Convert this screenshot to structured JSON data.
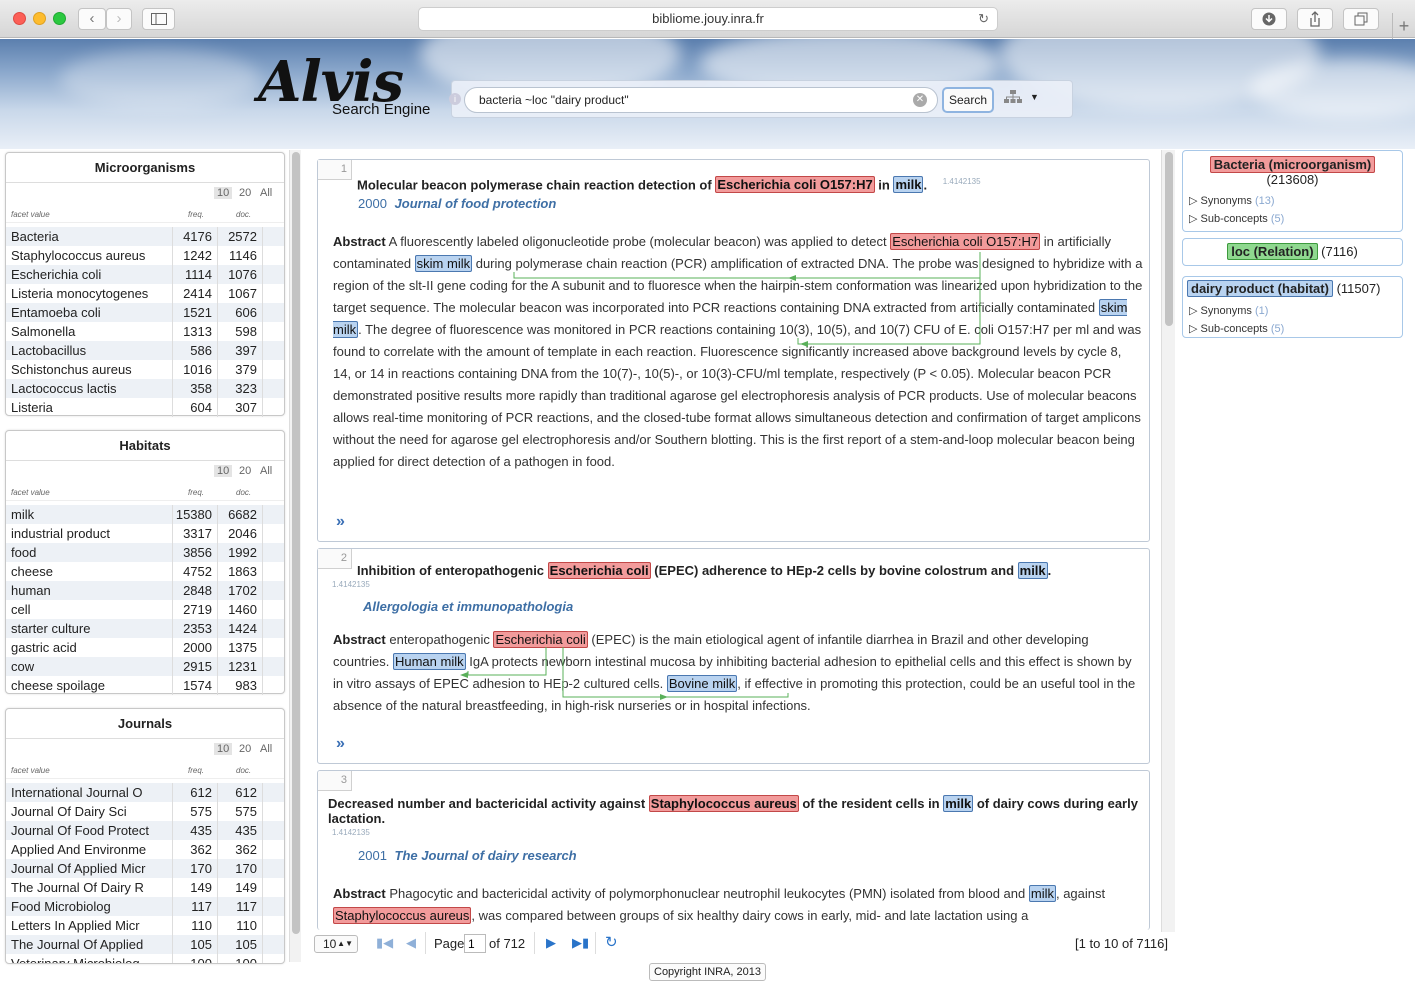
{
  "browser": {
    "url": "bibliome.jouy.inra.fr"
  },
  "logo": {
    "title": "Alvis",
    "subtitle": "Search Engine"
  },
  "search": {
    "query": "bacteria ~loc \"dairy product\"",
    "button": "Search"
  },
  "facets": {
    "page_sizes": [
      "10",
      "20",
      "All"
    ],
    "col_value": "facet value",
    "col_freq": "freq.",
    "col_doc": "doc.",
    "microorganisms": {
      "title": "Microorganisms",
      "rows": [
        {
          "name": "Bacteria",
          "freq": "4176",
          "doc": "2572"
        },
        {
          "name": "Staphylococcus aureus",
          "freq": "1242",
          "doc": "1146"
        },
        {
          "name": "Escherichia coli",
          "freq": "1114",
          "doc": "1076"
        },
        {
          "name": "Listeria monocytogenes",
          "freq": "2414",
          "doc": "1067"
        },
        {
          "name": "Entamoeba coli",
          "freq": "1521",
          "doc": "606"
        },
        {
          "name": "Salmonella",
          "freq": "1313",
          "doc": "598"
        },
        {
          "name": "Lactobacillus",
          "freq": "586",
          "doc": "397"
        },
        {
          "name": "Schistonchus aureus",
          "freq": "1016",
          "doc": "379"
        },
        {
          "name": "Lactococcus lactis",
          "freq": "358",
          "doc": "323"
        },
        {
          "name": "Listeria",
          "freq": "604",
          "doc": "307"
        }
      ]
    },
    "habitats": {
      "title": "Habitats",
      "rows": [
        {
          "name": "milk",
          "freq": "15380",
          "doc": "6682"
        },
        {
          "name": "industrial product",
          "freq": "3317",
          "doc": "2046"
        },
        {
          "name": "food",
          "freq": "3856",
          "doc": "1992"
        },
        {
          "name": "cheese",
          "freq": "4752",
          "doc": "1863"
        },
        {
          "name": "human",
          "freq": "2848",
          "doc": "1702"
        },
        {
          "name": "cell",
          "freq": "2719",
          "doc": "1460"
        },
        {
          "name": "starter culture",
          "freq": "2353",
          "doc": "1424"
        },
        {
          "name": "gastric acid",
          "freq": "2000",
          "doc": "1375"
        },
        {
          "name": "cow",
          "freq": "2915",
          "doc": "1231"
        },
        {
          "name": "cheese spoilage",
          "freq": "1574",
          "doc": "983"
        }
      ]
    },
    "journals": {
      "title": "Journals",
      "rows": [
        {
          "name": "International Journal O",
          "freq": "612",
          "doc": "612"
        },
        {
          "name": "Journal Of Dairy Sci",
          "freq": "575",
          "doc": "575"
        },
        {
          "name": "Journal Of Food Protect",
          "freq": "435",
          "doc": "435"
        },
        {
          "name": "Applied And Environme",
          "freq": "362",
          "doc": "362"
        },
        {
          "name": "Journal Of Applied Micr",
          "freq": "170",
          "doc": "170"
        },
        {
          "name": "The Journal Of Dairy R",
          "freq": "149",
          "doc": "149"
        },
        {
          "name": "Food Microbiolog",
          "freq": "117",
          "doc": "117"
        },
        {
          "name": "Letters In Applied Micr",
          "freq": "110",
          "doc": "110"
        },
        {
          "name": "The Journal Of Applied",
          "freq": "105",
          "doc": "105"
        },
        {
          "name": "Veterinary Microbiolog",
          "freq": "100",
          "doc": "100"
        }
      ]
    }
  },
  "results": [
    {
      "num": "1",
      "title_a": "Molecular beacon polymerase chain reaction detection of ",
      "title_b": "Escherichia coli O157:H7",
      "title_c": " in ",
      "title_d": "milk",
      "title_e": ".",
      "score": "1.4142135",
      "year": "2000",
      "journal": "Journal of food protection",
      "abstract_label": "Abstract",
      "abs": [
        " A fluorescently labeled oligonucleotide probe (molecular beacon) was applied to detect ",
        "Escherichia coli O157:H7",
        " in artificially contaminated ",
        "skim milk",
        " during polymerase chain reaction (PCR) amplification of extracted DNA. The probe was designed to hybridize with a region of the slt-II gene coding for the A subunit and to fluoresce when the hairpin-stem conformation was linearized upon hybridization to the target sequence. The molecular beacon was incorporated into PCR reactions containing DNA extracted from artificially contaminated ",
        "skim milk",
        ". The degree of fluorescence was monitored in PCR reactions containing 10(3), 10(5), and 10(7) CFU of E. coli O157:H7 per ml and was found to correlate with the amount of template in each reaction. Fluorescence significantly increased above background levels by cycle 8, 14, or 14 in reactions containing DNA from the 10(7)-, 10(5)-, or 10(3)-CFU/ml template, respectively (P < 0.05). Molecular beacon PCR demonstrated positive results more rapidly than traditional agarose gel electrophoresis analysis of PCR products. Use of molecular beacons allows real-time monitoring of PCR reactions, and the closed-tube format allows simultaneous detection and confirmation of target amplicons without the need for agarose gel electrophoresis and/or Southern blotting. This is the first report of a stem-and-loop molecular beacon being applied for direct detection of a pathogen in food."
      ],
      "more": "»"
    },
    {
      "num": "2",
      "title_a": "Inhibition of enteropathogenic ",
      "title_b": "Escherichia coli",
      "title_c": " (EPEC) adherence to HEp-2 cells by bovine colostrum and ",
      "title_d": "milk",
      "title_e": ".",
      "score": "1.4142135",
      "journal": "Allergologia et immunopathologia",
      "abstract_label": "Abstract",
      "abs": [
        " enteropathogenic ",
        "Escherichia coli",
        " (EPEC) is the main etiological agent of infantile diarrhea in Brazil and other developing countries. ",
        "Human milk",
        " IgA protects newborn intestinal mucosa by inhibiting bacterial adhesion to epithelial cells and this effect is shown by in vitro assays of EPEC adhesion to HEp-2 cultured cells. ",
        "Bovine milk",
        ", if effective in promoting this protection, could be an useful tool in the absence of the natural breastfeeding, in high-risk nurseries or in hospital infections."
      ],
      "more": "»"
    },
    {
      "num": "3",
      "title_a": "Decreased number and bactericidal activity against ",
      "title_b": "Staphylococcus aureus",
      "title_c": " of the resident cells in ",
      "title_d": "milk",
      "title_e": " of dairy cows during early lactation.",
      "score": "1.4142135",
      "year": "2001",
      "journal": "The Journal of dairy research",
      "abstract_label": "Abstract",
      "abs": [
        " Phagocytic and bactericidal activity of polymorphonuclear neutrophil leukocytes (PMN) isolated from blood and ",
        "milk",
        ", against ",
        "Staphylococcus aureus",
        ", was compared between groups of six healthy dairy cows in early, mid- and late lactation using a"
      ]
    }
  ],
  "pager": {
    "per_page": "10",
    "page_label": "Page",
    "page": "1",
    "of": "of 712",
    "range": "[1 to 10 of 7116]"
  },
  "concepts": {
    "bacteria": {
      "label": "Bacteria (microorganism)",
      "count": "(213608)",
      "syn": "Synonyms",
      "syn_n": "(13)",
      "sub": "Sub-concepts",
      "sub_n": "(5)"
    },
    "relation": {
      "label": "loc (Relation)",
      "count": "(7116)"
    },
    "dairy": {
      "label": "dairy product (habitat)",
      "count": "(11507)",
      "syn": "Synonyms",
      "syn_n": "(1)",
      "sub": "Sub-concepts",
      "sub_n": "(5)"
    }
  },
  "footer": {
    "copyright": "Copyright INRA, 2013"
  }
}
